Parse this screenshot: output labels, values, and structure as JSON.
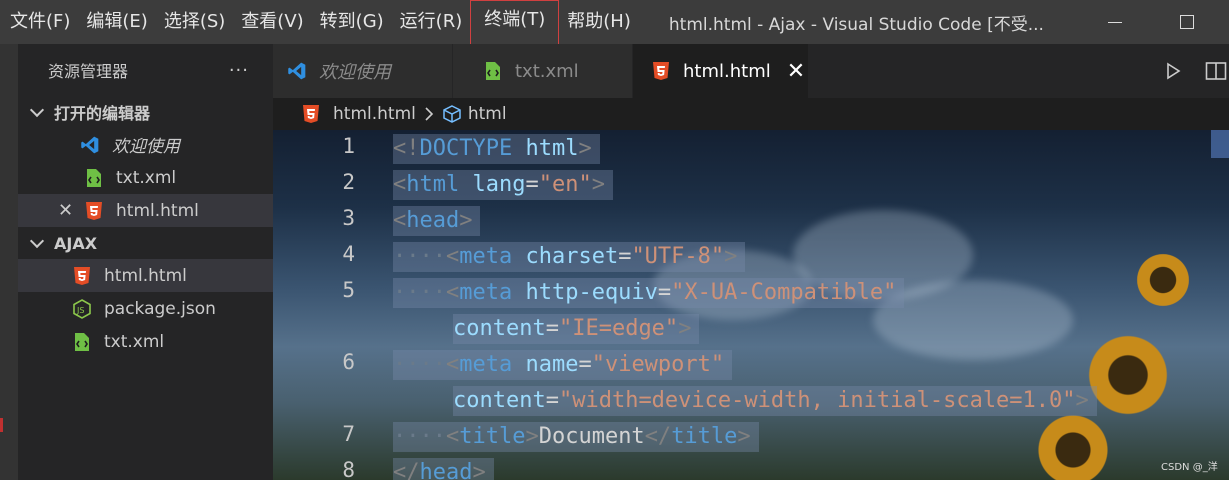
{
  "menu": [
    "文件(F)",
    "编辑(E)",
    "选择(S)",
    "查看(V)",
    "转到(G)",
    "运行(R)",
    "终端(T)",
    "帮助(H)"
  ],
  "window_title": "html.html - Ajax - Visual Studio Code [不受...",
  "sidebar": {
    "title": "资源管理器",
    "more": "···",
    "open_editors": {
      "label": "打开的编辑器",
      "items": [
        {
          "label": "欢迎使用",
          "icon": "vscode-icon"
        },
        {
          "label": "txt.xml",
          "icon": "xml-file-icon"
        },
        {
          "label": "html.html",
          "icon": "html5-icon",
          "close": "✕"
        }
      ]
    },
    "project": {
      "label": "AJAX",
      "items": [
        {
          "label": "html.html",
          "icon": "html5-icon"
        },
        {
          "label": "package.json",
          "icon": "nodejs-icon"
        },
        {
          "label": "txt.xml",
          "icon": "xml-file-icon"
        }
      ]
    }
  },
  "tabs": [
    {
      "label": "欢迎使用",
      "icon": "vscode-icon"
    },
    {
      "label": "txt.xml",
      "icon": "xml-file-icon"
    },
    {
      "label": "html.html",
      "icon": "html5-icon",
      "close": "✕"
    }
  ],
  "breadcrumb": {
    "file": "html.html",
    "symbol": "html"
  },
  "line_numbers": [
    "1",
    "2",
    "3",
    "4",
    "5",
    "6",
    "7",
    "8"
  ],
  "code": {
    "l1": {
      "open": "<!",
      "name": "DOCTYPE",
      "sp": " ",
      "attr": "html",
      "close": ">"
    },
    "l2": {
      "open": "<",
      "tag": "html",
      "sp": " ",
      "attr": "lang",
      "eq": "=",
      "val": "\"en\"",
      "close": ">"
    },
    "l3": {
      "open": "<",
      "tag": "head",
      "close": ">"
    },
    "l4": {
      "indent": "····",
      "open": "<",
      "tag": "meta",
      "sp": " ",
      "attr": "charset",
      "eq": "=",
      "val": "\"UTF-8\"",
      "close": ">"
    },
    "l5": {
      "indent": "····",
      "open": "<",
      "tag": "meta",
      "sp": " ",
      "attr": "http-equiv",
      "eq": "=",
      "val": "\"X-UA-Compatible\""
    },
    "l5b": {
      "attr": "content",
      "eq": "=",
      "val": "\"IE=edge\"",
      "close": ">"
    },
    "l6": {
      "indent": "····",
      "open": "<",
      "tag": "meta",
      "sp": " ",
      "attr": "name",
      "eq": "=",
      "val": "\"viewport\""
    },
    "l6b": {
      "attr": "content",
      "eq": "=",
      "val": "\"width=device-width, initial-scale=1.0\"",
      "close": ">"
    },
    "l7": {
      "indent": "····",
      "open": "<",
      "tag": "title",
      "close": ">",
      "text": "Document",
      "open2": "</",
      "tag2": "title",
      "close2": ">"
    },
    "l8": {
      "open": "</",
      "tag": "head",
      "close": ">"
    }
  },
  "watermark": "CSDN @_洋"
}
